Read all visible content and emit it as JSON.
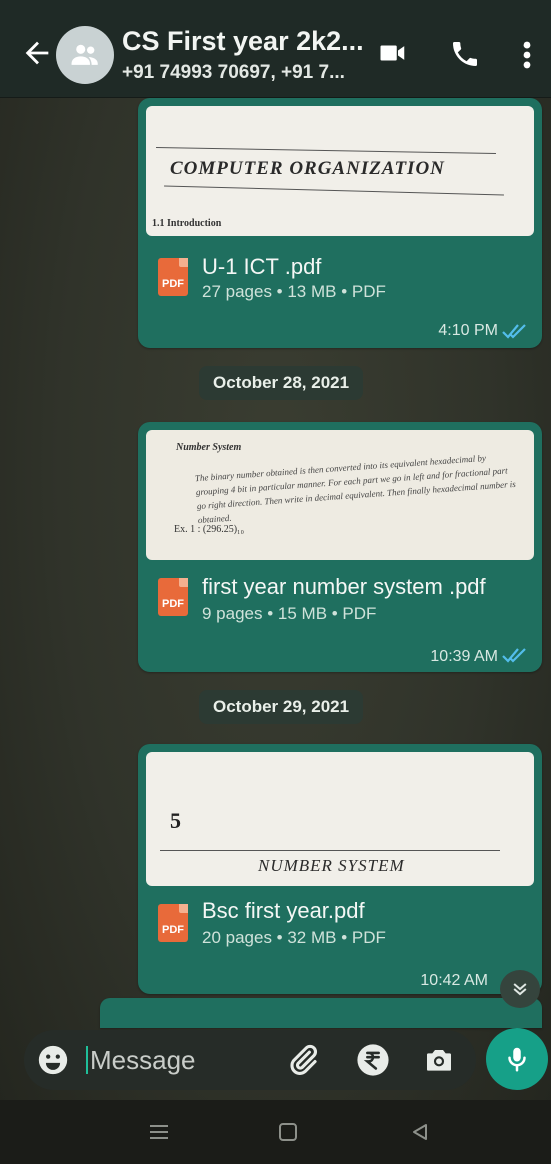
{
  "header": {
    "title": "CS First year 2k2...",
    "subtitle": "+91 74993 70697, +91 7..."
  },
  "messages": [
    {
      "doc_title": "COMPUTER ORGANIZATION",
      "doc_section": "1.1 Introduction",
      "file_name": "U-1 ICT .pdf",
      "meta": "27 pages • 13 MB • PDF",
      "time": "4:10 PM",
      "pdf_label": "PDF"
    },
    {
      "doc_heading": "Number System",
      "doc_body": "The binary number obtained is then converted into its equivalent hexadecimal by grouping 4 bit in particular manner. For each part we go in left and for fractional part go right direction. Then write in decimal equivalent. Then finally hexadecimal number is obtained.",
      "doc_ex": "Ex. 1 : (296.25)₁₀",
      "file_name": "first year number system .pdf",
      "meta": "9 pages • 15 MB • PDF",
      "time": "10:39 AM",
      "pdf_label": "PDF"
    },
    {
      "doc_number": "5",
      "doc_title": "NUMBER SYSTEM",
      "file_name": "Bsc first year.pdf",
      "meta": "20 pages • 32 MB • PDF",
      "time": "10:42 AM",
      "pdf_label": "PDF"
    }
  ],
  "dates": [
    "October 28, 2021",
    "October 29, 2021"
  ],
  "composer": {
    "placeholder": "Message"
  },
  "colors": {
    "bubble": "#1f6f5f",
    "accent": "#16a088",
    "tick_read": "#53bdeb"
  }
}
